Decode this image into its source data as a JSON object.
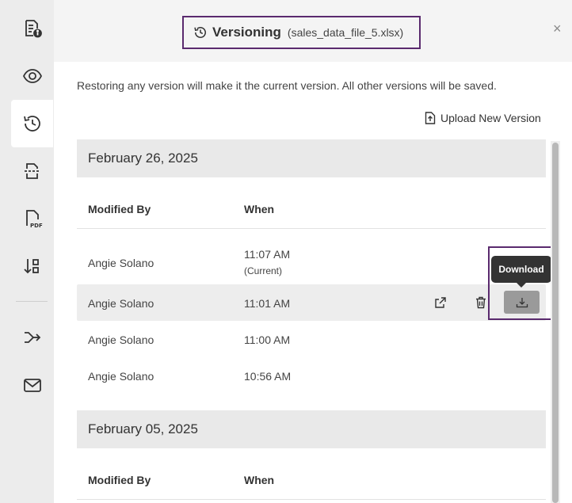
{
  "sidebar": {
    "items": [
      {
        "icon": "document-info-icon"
      },
      {
        "icon": "eye-icon"
      },
      {
        "icon": "history-icon",
        "active": true
      },
      {
        "icon": "document-compare-icon"
      },
      {
        "icon": "pdf-file-icon"
      },
      {
        "icon": "sort-icon"
      },
      {
        "icon": "share-arrow-icon"
      },
      {
        "icon": "mail-icon"
      }
    ]
  },
  "header": {
    "title": "Versioning",
    "file_name": "(sales_data_file_5.xlsx)",
    "close_label": "×"
  },
  "info_text": "Restoring any version will make it the current version. All other versions will be saved.",
  "upload_label": "Upload New Version",
  "groups": [
    {
      "date": "February 26, 2025",
      "col_modified": "Modified By",
      "col_when": "When",
      "rows": [
        {
          "by": "Angie Solano",
          "when": "11:07 AM",
          "note": "(Current)"
        },
        {
          "by": "Angie Solano",
          "when": "11:01 AM"
        },
        {
          "by": "Angie Solano",
          "when": "11:00 AM"
        },
        {
          "by": "Angie Solano",
          "when": "10:56 AM"
        }
      ]
    },
    {
      "date": "February 05, 2025",
      "col_modified": "Modified By",
      "col_when": "When"
    }
  ],
  "tooltip": "Download",
  "colors": {
    "accent_border": "#5a2a6e",
    "hover_row": "#ededed",
    "download_btn": "#9a9a9a"
  }
}
